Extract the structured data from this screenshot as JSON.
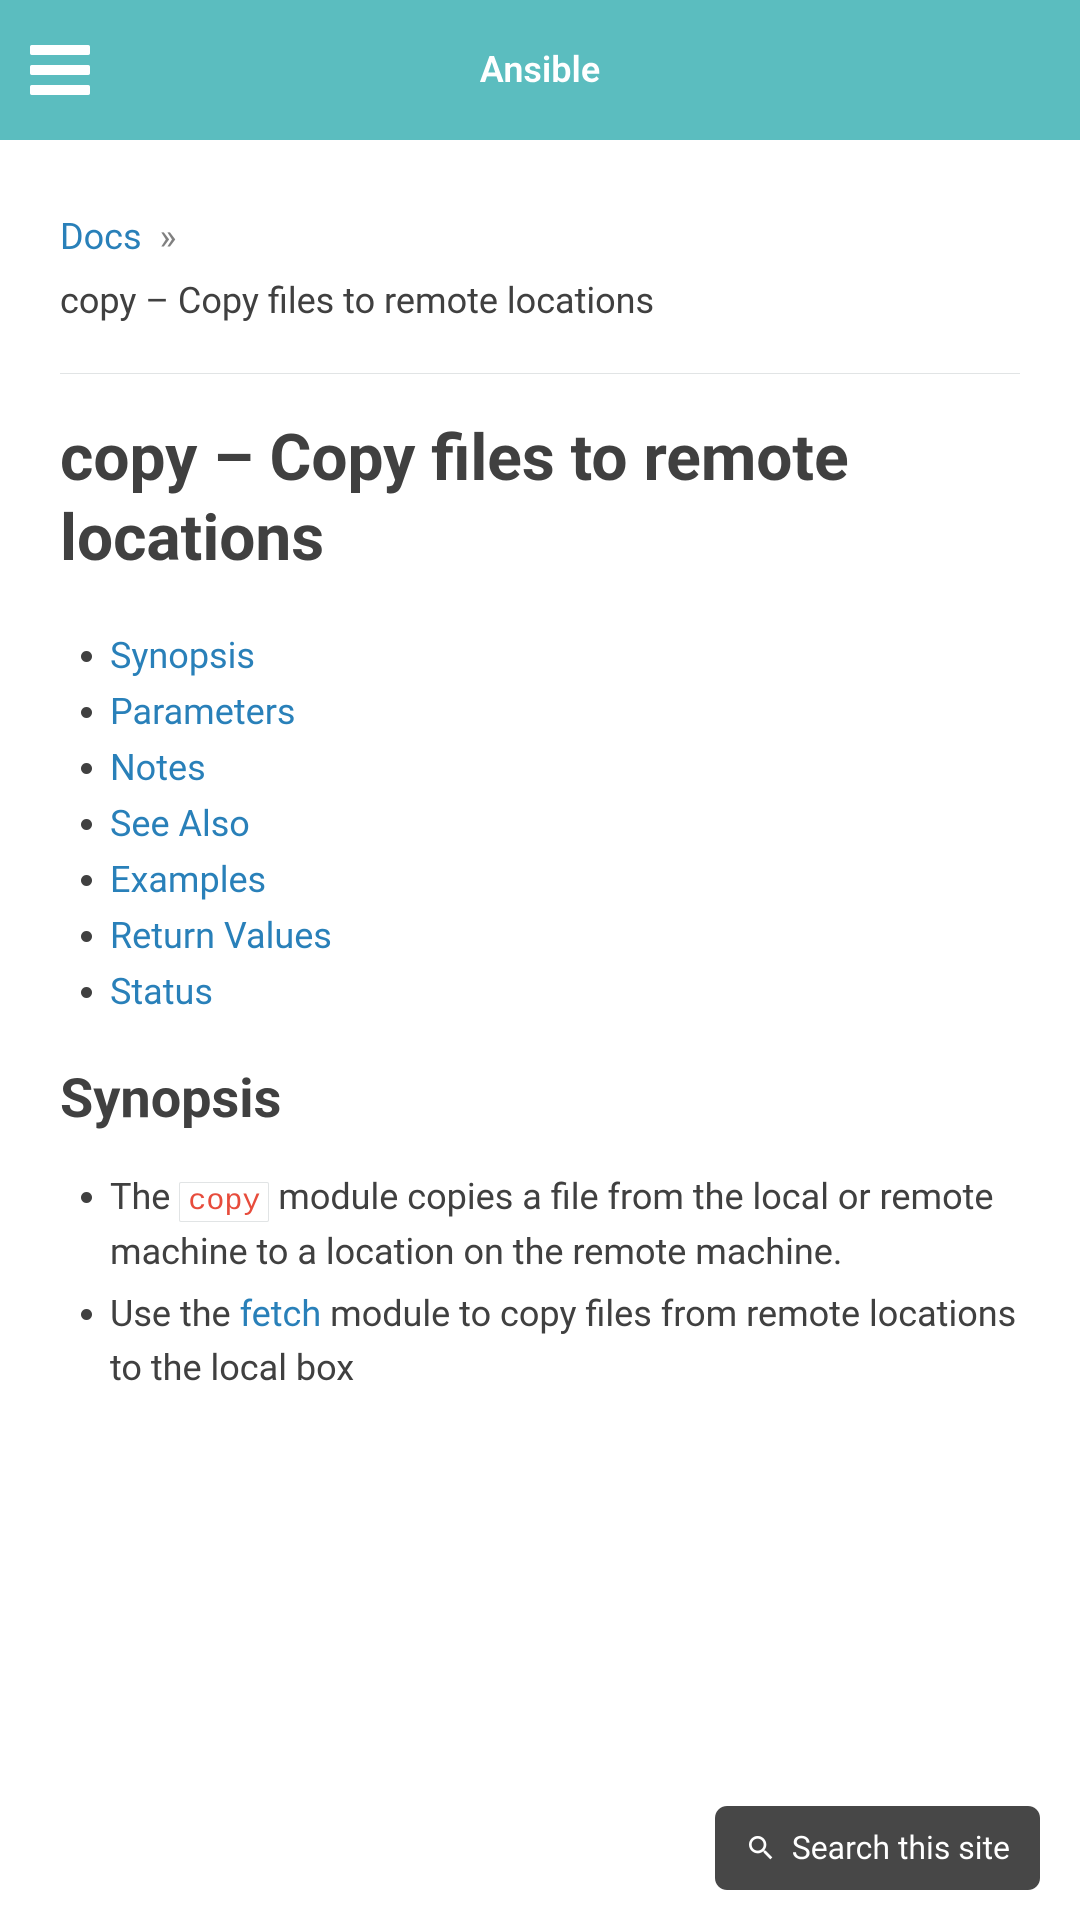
{
  "header": {
    "title": "Ansible"
  },
  "breadcrumb": {
    "root": "Docs",
    "separator": "»",
    "current": "copy – Copy files to remote locations"
  },
  "page": {
    "title": "copy – Copy files to remote locations"
  },
  "toc": [
    {
      "label": "Synopsis"
    },
    {
      "label": "Parameters"
    },
    {
      "label": "Notes"
    },
    {
      "label": "See Also"
    },
    {
      "label": "Examples"
    },
    {
      "label": "Return Values"
    },
    {
      "label": "Status"
    }
  ],
  "synopsis": {
    "heading": "Synopsis",
    "item1_pre": "The ",
    "item1_code": "copy",
    "item1_post": " module copies a file from the local or remote machine to a location on the remote machine.",
    "item2_pre": "Use the ",
    "item2_link": "fetch",
    "item2_post": " module to copy files from remote locations to the local box"
  },
  "search": {
    "label": "Search this site"
  }
}
